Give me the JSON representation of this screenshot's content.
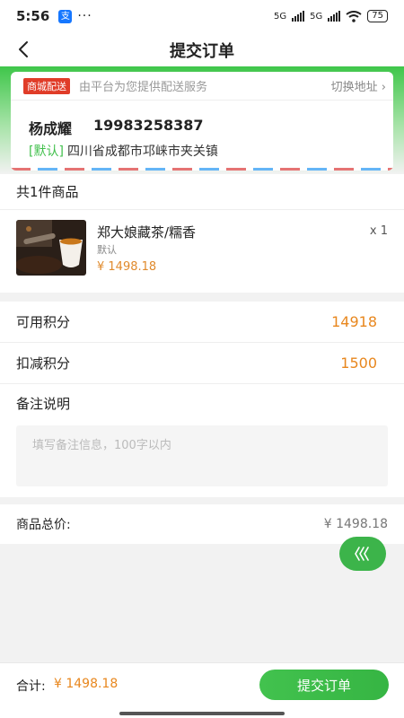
{
  "status_bar": {
    "time": "5:56",
    "app_icon": "支",
    "dots": "···",
    "net1": "5G",
    "net2": "5G",
    "battery": "75"
  },
  "nav": {
    "title": "提交订单"
  },
  "address": {
    "delivery_badge": "商城配送",
    "delivery_text": "由平台为您提供配送服务",
    "switch_label": "切换地址 ›",
    "name": "杨成耀",
    "phone": "19983258387",
    "default_tag": "[默认]",
    "detail": "四川省成都市邛崃市夹关镇"
  },
  "goods": {
    "header": "共1件商品",
    "items": [
      {
        "name": "郑大娘藏茶/糯香",
        "spec": "默认",
        "price": "¥ 1498.18",
        "qty": "x 1"
      }
    ]
  },
  "points": {
    "available_label": "可用积分",
    "available_value": "14918",
    "deduct_label": "扣减积分",
    "deduct_value": "1500"
  },
  "remark": {
    "label": "备注说明",
    "placeholder": "填写备注信息，100字以内"
  },
  "summary": {
    "label": "商品总价:",
    "value": "¥ 1498.18"
  },
  "bottom": {
    "total_label": "合计:",
    "total_value": "¥ 1498.18",
    "submit_label": "提交订单"
  },
  "colors": {
    "accent_green": "#3fc64a",
    "price_orange": "#e8871e",
    "badge_red": "#e03c28"
  }
}
